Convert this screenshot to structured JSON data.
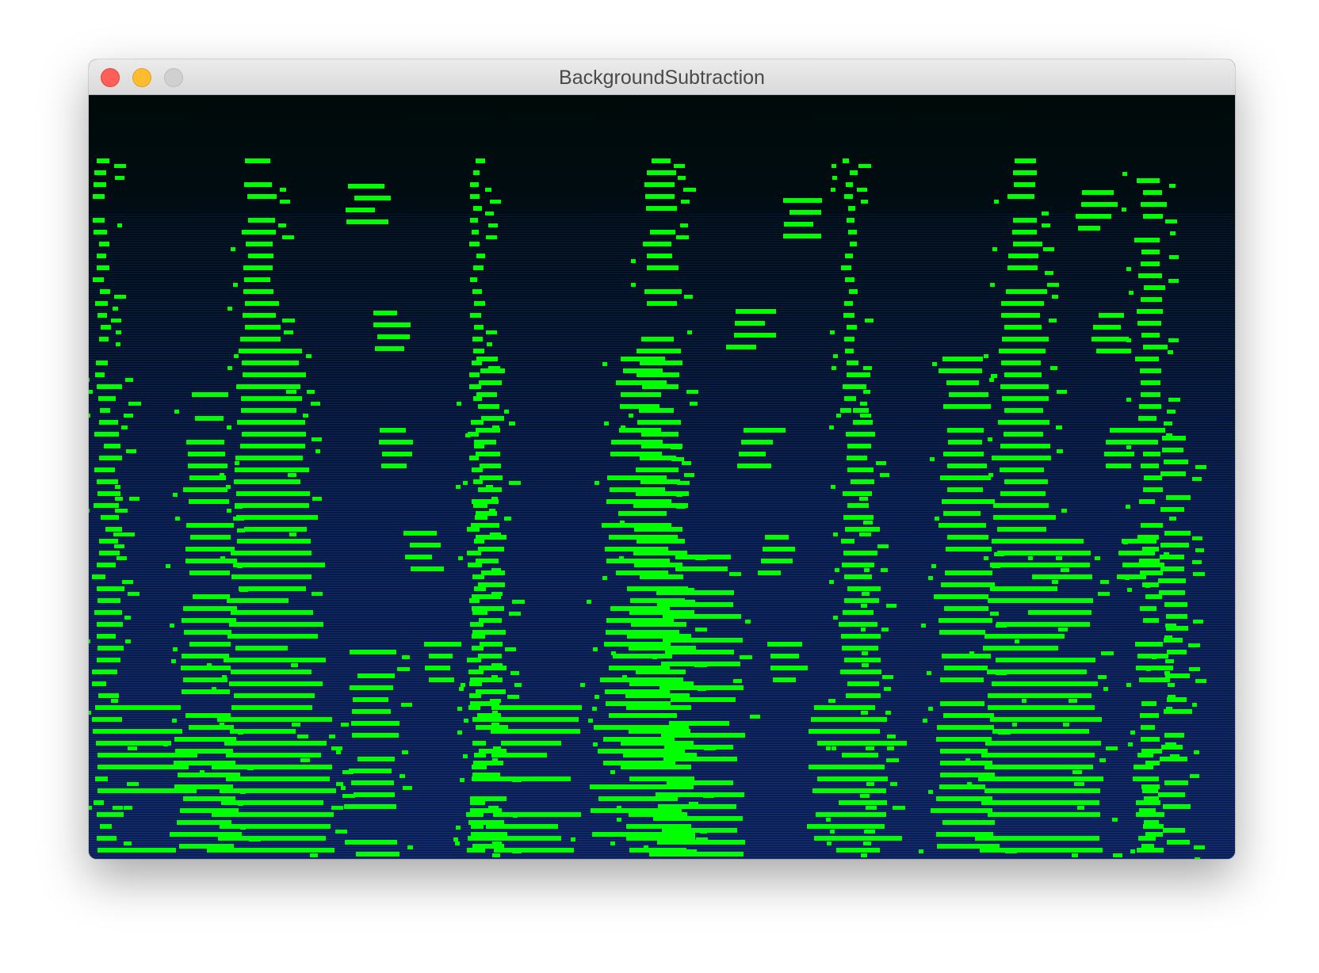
{
  "window": {
    "title": "BackgroundSubtraction"
  },
  "controls": {
    "close_icon": "close-icon",
    "minimize_icon": "minimize-icon",
    "zoom_icon": "zoom-icon"
  },
  "colors": {
    "foreground_mask": "#00ff00",
    "background_top": "#000a08",
    "background_bottom": "#0b1e52",
    "scanline": "#1c3a8e"
  }
}
